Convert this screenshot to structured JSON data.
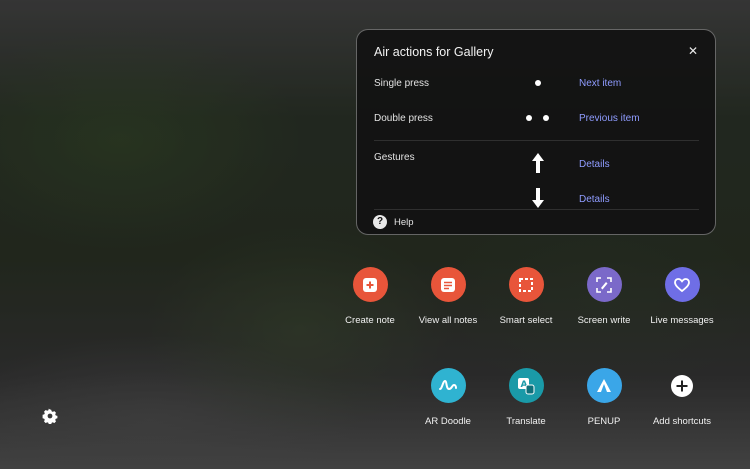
{
  "panel": {
    "title": "Air actions for Gallery",
    "close_glyph": "✕",
    "rows": [
      {
        "label": "Single press",
        "action": "Next item"
      },
      {
        "label": "Double press",
        "action": "Previous item"
      },
      {
        "label": "Gestures",
        "actions": [
          "Details",
          "Details"
        ]
      }
    ],
    "help_glyph": "?",
    "help_label": "Help"
  },
  "shortcuts": [
    {
      "label": "Create note",
      "color": "#e8553a",
      "icon": "create-note-icon"
    },
    {
      "label": "View all notes",
      "color": "#e8553a",
      "icon": "notes-list-icon"
    },
    {
      "label": "Smart select",
      "color": "#e8553a",
      "icon": "smart-select-icon"
    },
    {
      "label": "Screen write",
      "color": "#7b69c9",
      "icon": "screen-write-icon"
    },
    {
      "label": "Live messages",
      "color": "#6f6ee6",
      "icon": "heart-icon"
    },
    {
      "label": "AR Doodle",
      "color": "#2fb3d1",
      "icon": "ar-doodle-icon"
    },
    {
      "label": "Translate",
      "color": "#1a9aa8",
      "icon": "translate-icon"
    },
    {
      "label": "PENUP",
      "color": "#3aa6e8",
      "icon": "penup-icon"
    },
    {
      "label": "Add shortcuts",
      "color": "#ffffff",
      "icon": "add-icon"
    }
  ],
  "settings_icon": "gear-icon"
}
